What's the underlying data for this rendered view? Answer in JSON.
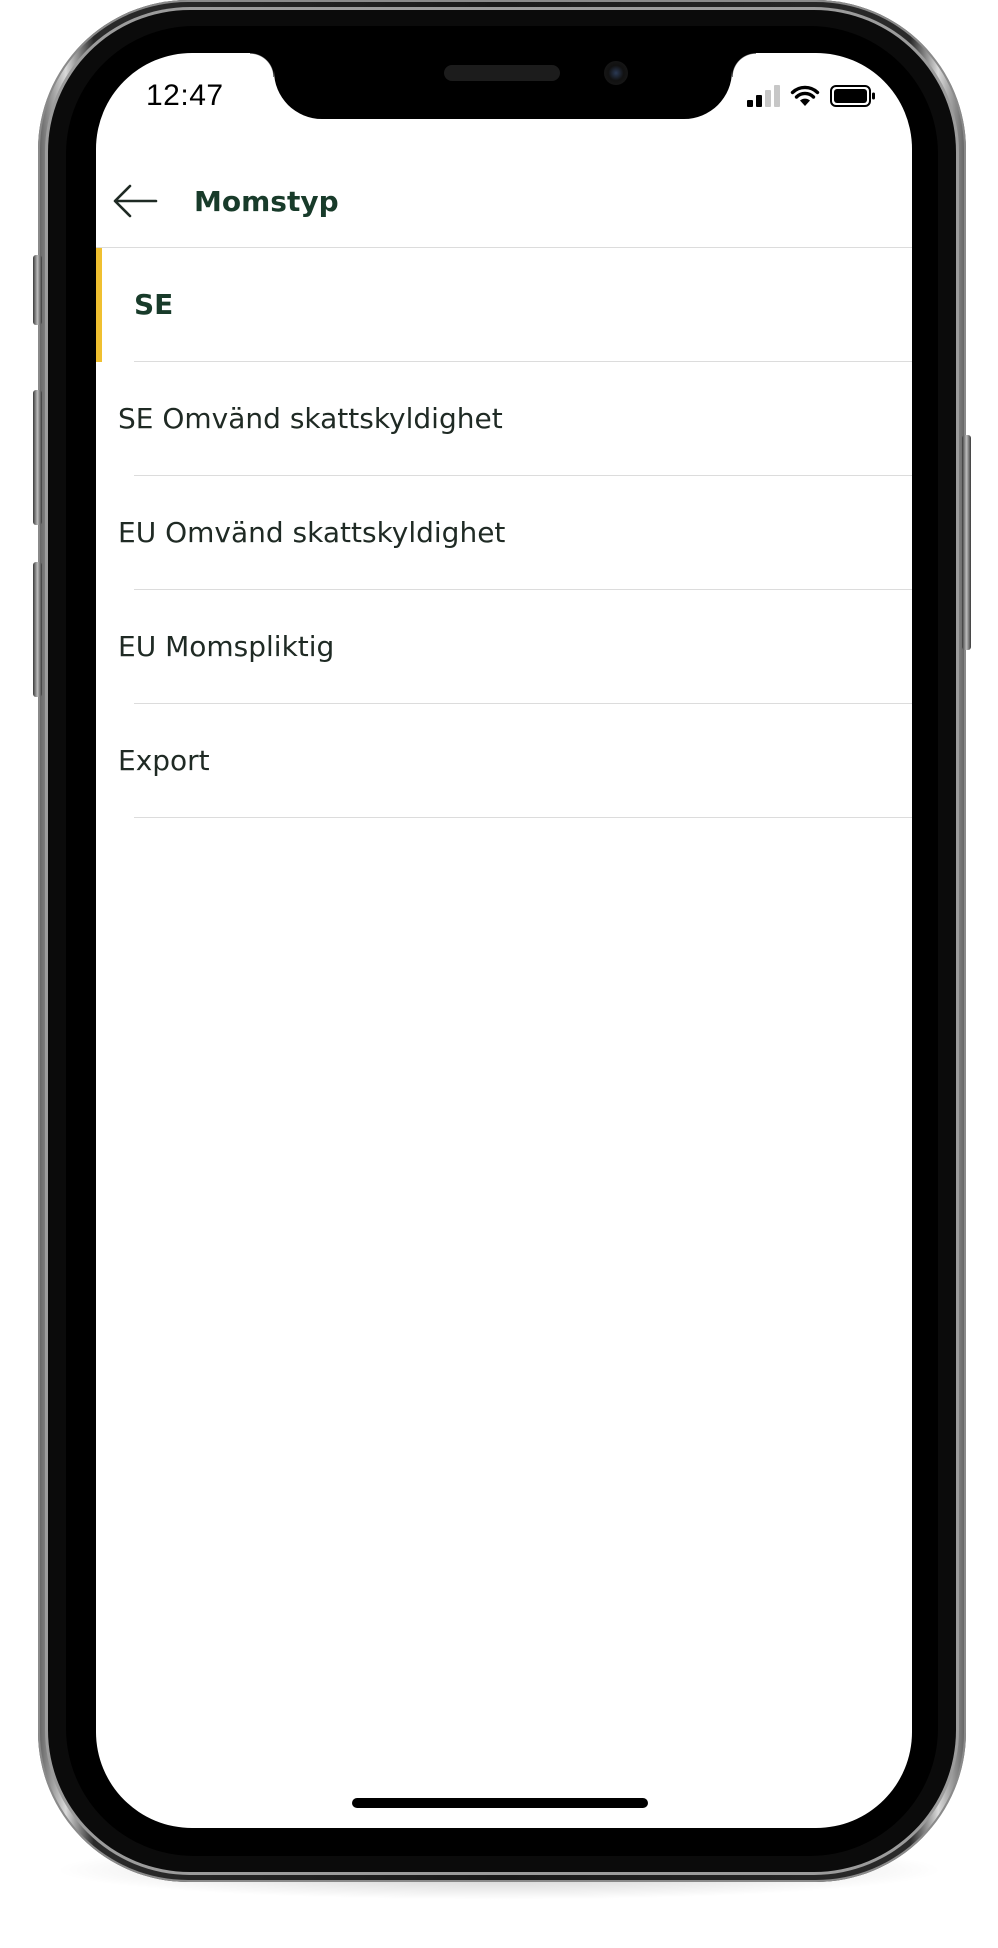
{
  "status_bar": {
    "time": "12:47"
  },
  "header": {
    "title": "Momstyp",
    "back_icon": "arrow-left-icon"
  },
  "options": [
    {
      "label": "SE",
      "selected": true
    },
    {
      "label": "SE Omvänd skattskyldighet",
      "selected": false
    },
    {
      "label": "EU Omvänd skattskyldighet",
      "selected": false
    },
    {
      "label": "EU Momspliktig",
      "selected": false
    },
    {
      "label": "Export",
      "selected": false
    }
  ],
  "colors": {
    "accent": "#f0c030",
    "title_text": "#183b2a",
    "item_text": "#1f2a24",
    "divider": "#dcdcdc"
  }
}
